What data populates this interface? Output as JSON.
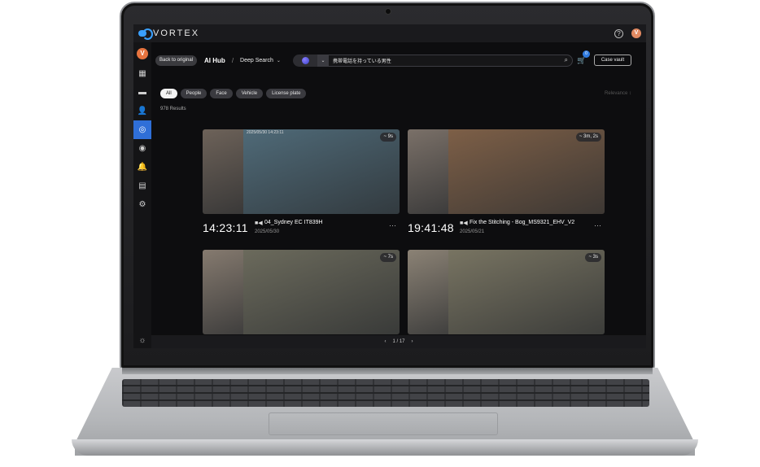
{
  "app": {
    "brand": "VORTEX",
    "user_initial": "V",
    "help": "?"
  },
  "nav": {
    "items": [
      {
        "name": "layout",
        "glyph": "▦"
      },
      {
        "name": "cameras",
        "glyph": "▬"
      },
      {
        "name": "people",
        "glyph": "👤"
      },
      {
        "name": "ai-hub",
        "glyph": "◎"
      },
      {
        "name": "profile",
        "glyph": "◉"
      },
      {
        "name": "alerts",
        "glyph": "🔔"
      },
      {
        "name": "archive",
        "glyph": "▤"
      },
      {
        "name": "settings",
        "glyph": "⚙"
      }
    ],
    "active_index": 3,
    "theme_glyph": "☼"
  },
  "header": {
    "back_label": "Back to original",
    "hub_label": "AI Hub",
    "separator": "/",
    "section_label": "Deep Search",
    "chevron": "⌄"
  },
  "search": {
    "mode_chevron": "⌄",
    "query": "携帯電話を持っている男性",
    "search_glyph": "⌕"
  },
  "cart": {
    "glyph": "🛒",
    "count": "0"
  },
  "case_vault_label": "Case vault",
  "filters": [
    "All",
    "People",
    "Face",
    "Vehicle",
    "License plate"
  ],
  "sort_label": "Relevance  ↕",
  "results_label": "978 Results",
  "results": [
    {
      "time": "14:23:11",
      "camera": "04_Sydney EC IT839H",
      "date": "2025/05/30",
      "duration": "~ 9s",
      "stamp": "2025/05/30 14:23:11",
      "colors": {
        "crop": "#6d6259",
        "scene": "#4f6a78"
      }
    },
    {
      "time": "19:41:48",
      "camera": "Fix the Stitching - Bog_MS9321_EHV_V2",
      "date": "2025/05/21",
      "duration": "~ 3m, 2s",
      "stamp": "",
      "colors": {
        "crop": "#7a7068",
        "scene": "#7d5f47"
      }
    },
    {
      "time": "",
      "camera": "",
      "date": "",
      "duration": "~ 7s",
      "stamp": "",
      "colors": {
        "crop": "#857a6f",
        "scene": "#6b6a5c"
      }
    },
    {
      "time": "",
      "camera": "",
      "date": "",
      "duration": "~ 3s",
      "stamp": "",
      "colors": {
        "crop": "#8b8275",
        "scene": "#787462"
      }
    }
  ],
  "pager": {
    "prev": "‹",
    "label": "1 / 17",
    "next": "›"
  },
  "icons": {
    "camera": "■◀",
    "more": "···"
  }
}
